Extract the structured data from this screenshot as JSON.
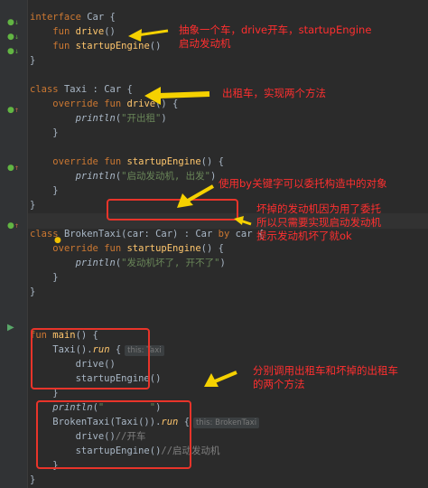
{
  "editor": {
    "lines": [
      {
        "parts": [
          [
            "kw",
            "interface "
          ],
          [
            "",
            "Car {"
          ]
        ]
      },
      {
        "parts": [
          [
            "",
            "    "
          ],
          [
            "kw",
            "fun "
          ],
          [
            "fn",
            "drive"
          ],
          [
            "",
            "()"
          ]
        ]
      },
      {
        "parts": [
          [
            "",
            "    "
          ],
          [
            "kw",
            "fun "
          ],
          [
            "fn",
            "startupEngine"
          ],
          [
            "",
            "()"
          ]
        ]
      },
      {
        "parts": [
          [
            "",
            "}"
          ]
        ]
      },
      {
        "parts": []
      },
      {
        "parts": [
          [
            "kw",
            "class "
          ],
          [
            "",
            "Taxi : Car {"
          ]
        ]
      },
      {
        "parts": [
          [
            "",
            "    "
          ],
          [
            "kw",
            "override fun "
          ],
          [
            "fn",
            "drive"
          ],
          [
            "",
            "() {"
          ]
        ]
      },
      {
        "parts": [
          [
            "",
            "        "
          ],
          [
            "it",
            "println"
          ],
          [
            "",
            "("
          ],
          [
            "str",
            "\"开出租\""
          ],
          [
            "",
            ")"
          ]
        ]
      },
      {
        "parts": [
          [
            "",
            "    }"
          ]
        ]
      },
      {
        "parts": []
      },
      {
        "parts": [
          [
            "",
            "    "
          ],
          [
            "kw",
            "override fun "
          ],
          [
            "fn",
            "startupEngine"
          ],
          [
            "",
            "() {"
          ]
        ]
      },
      {
        "parts": [
          [
            "",
            "        "
          ],
          [
            "it",
            "println"
          ],
          [
            "",
            "("
          ],
          [
            "str",
            "\"启动发动机, 出发\""
          ],
          [
            "",
            ")"
          ]
        ]
      },
      {
        "parts": [
          [
            "",
            "    }"
          ]
        ]
      },
      {
        "parts": [
          [
            "",
            "}"
          ]
        ]
      },
      {
        "parts": []
      },
      {
        "parts": [
          [
            "kw",
            "class "
          ],
          [
            "",
            "BrokenTaxi(car: Car) : Car "
          ],
          [
            "kw",
            "by "
          ],
          [
            "",
            "car {"
          ]
        ]
      },
      {
        "parts": [
          [
            "",
            "    "
          ],
          [
            "kw",
            "override fun "
          ],
          [
            "fn",
            "startupEngine"
          ],
          [
            "",
            "() {"
          ]
        ]
      },
      {
        "parts": [
          [
            "",
            "        "
          ],
          [
            "it",
            "println"
          ],
          [
            "",
            "("
          ],
          [
            "str",
            "\"发动机坏了, 开不了\""
          ],
          [
            "",
            ")"
          ]
        ]
      },
      {
        "parts": [
          [
            "",
            "    }"
          ]
        ]
      },
      {
        "parts": [
          [
            "",
            "}"
          ]
        ]
      },
      {
        "parts": []
      },
      {
        "parts": []
      },
      {
        "parts": [
          [
            "kw",
            "fun "
          ],
          [
            "fn",
            "main"
          ],
          [
            "",
            "() {"
          ]
        ]
      },
      {
        "parts": [
          [
            "",
            "    Taxi()."
          ],
          [
            "fn it",
            "run"
          ],
          [
            "",
            " {"
          ],
          [
            "hint",
            "this: Taxi"
          ]
        ]
      },
      {
        "parts": [
          [
            "",
            "        drive()"
          ]
        ]
      },
      {
        "parts": [
          [
            "",
            "        startupEngine()"
          ]
        ]
      },
      {
        "parts": [
          [
            "",
            "    }"
          ]
        ]
      },
      {
        "parts": [
          [
            "",
            "    "
          ],
          [
            "it",
            "println"
          ],
          [
            "",
            "("
          ],
          [
            "str",
            "\"        \""
          ],
          [
            "",
            ")"
          ]
        ]
      },
      {
        "parts": [
          [
            "",
            "    BrokenTaxi(Taxi())."
          ],
          [
            "fn it",
            "run"
          ],
          [
            "",
            " {"
          ],
          [
            "hint",
            "this: BrokenTaxi"
          ]
        ]
      },
      {
        "parts": [
          [
            "",
            "        drive()"
          ],
          [
            "cmt",
            "//开车"
          ]
        ]
      },
      {
        "parts": [
          [
            "",
            "        startupEngine()"
          ],
          [
            "cmt",
            "//启动发动机"
          ]
        ]
      },
      {
        "parts": [
          [
            "",
            "    }"
          ]
        ]
      },
      {
        "parts": [
          [
            "",
            "}"
          ]
        ]
      }
    ]
  },
  "annotations": {
    "a1_line1": "抽象一个车，drive开车，startupEngine",
    "a1_line2": "启动发动机",
    "a2": "出租车，实现两个方法",
    "a3": "使用by关键字可以委托构造中的对象",
    "a4_line1": "坏掉的发动机因为用了委托",
    "a4_line2": "所以只需要实现启动发动机",
    "a4_line3": "提示发动机坏了就ok",
    "a5_line1": "分别调用出租车和坏掉的出租车",
    "a5_line2": "的两个方法"
  },
  "colors": {
    "background": "#2b2b2b",
    "keyword": "#cc7832",
    "function": "#ffc66d",
    "string": "#6a8759",
    "comment": "#808080",
    "annotation": "#ff2f2f",
    "arrow": "#f5d100"
  },
  "gutter_icons": [
    "implemented-icon",
    "override-icon",
    "run-icon"
  ]
}
